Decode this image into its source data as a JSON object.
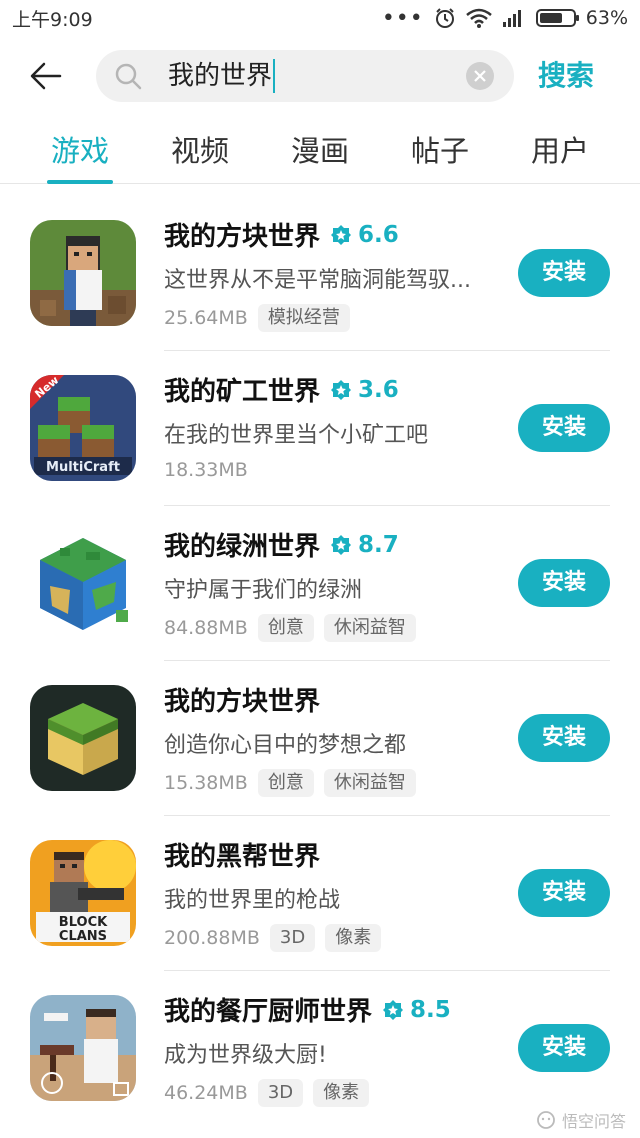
{
  "status_bar": {
    "time": "上午9:09",
    "battery_percent_text": "63%",
    "battery_level": 0.63
  },
  "search": {
    "query": "我的世界",
    "button_label": "搜索"
  },
  "tabs": [
    {
      "label": "游戏",
      "active": true
    },
    {
      "label": "视频",
      "active": false
    },
    {
      "label": "漫画",
      "active": false
    },
    {
      "label": "帖子",
      "active": false
    },
    {
      "label": "用户",
      "active": false
    }
  ],
  "apps": [
    {
      "name": "我的方块世界",
      "rating": "6.6",
      "desc": "这世界从不是平常脑洞能驾驭...",
      "size": "25.64MB",
      "tags": [
        "模拟经营"
      ],
      "install": "安装",
      "icon": "block-world-character-icon"
    },
    {
      "name": "我的矿工世界",
      "rating": "3.6",
      "desc": "在我的世界里当个小矿工吧",
      "size": "18.33MB",
      "tags": [],
      "install": "安装",
      "icon": "multicraft-icon"
    },
    {
      "name": "我的绿洲世界",
      "rating": "8.7",
      "desc": "守护属于我们的绿洲",
      "size": "84.88MB",
      "tags": [
        "创意",
        "休闲益智"
      ],
      "install": "安装",
      "icon": "globe-cube-icon"
    },
    {
      "name": "我的方块世界",
      "rating": "",
      "desc": "创造你心目中的梦想之都",
      "size": "15.38MB",
      "tags": [
        "创意",
        "休闲益智"
      ],
      "install": "安装",
      "icon": "grass-block-icon"
    },
    {
      "name": "我的黑帮世界",
      "rating": "",
      "desc": "我的世界里的枪战",
      "size": "200.88MB",
      "tags": [
        "3D",
        "像素"
      ],
      "install": "安装",
      "icon": "block-clans-icon"
    },
    {
      "name": "我的餐厅厨师世界",
      "rating": "8.5",
      "desc": "成为世界级大厨!",
      "size": "46.24MB",
      "tags": [
        "3D",
        "像素"
      ],
      "install": "安装",
      "icon": "restaurant-chef-icon"
    }
  ],
  "watermark": "悟空问答",
  "colors": {
    "accent": "#19b0c1"
  }
}
